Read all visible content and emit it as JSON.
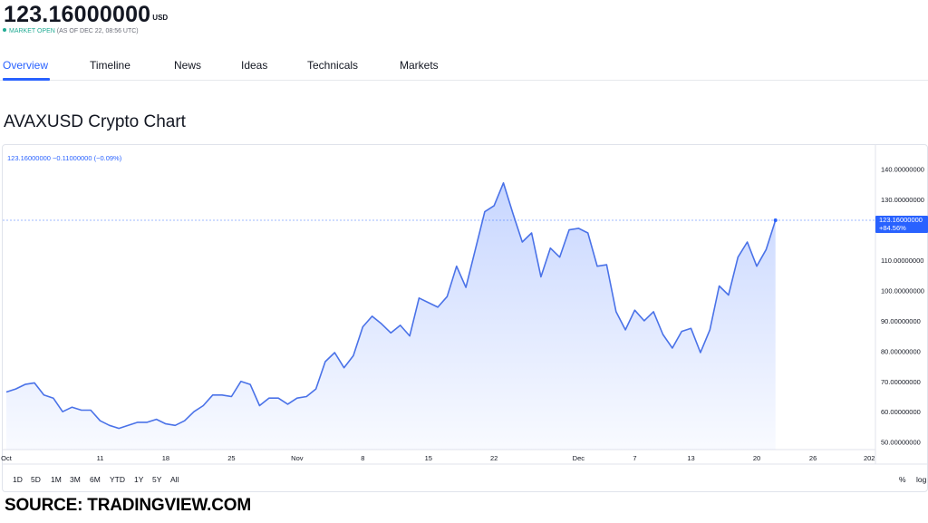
{
  "header": {
    "price": "123.16000000",
    "currency": "USD",
    "market_status": "MARKET OPEN",
    "as_of": "(AS OF DEC 22, 08:56 UTC)"
  },
  "tabs": [
    {
      "label": "Overview",
      "active": true
    },
    {
      "label": "Timeline",
      "active": false
    },
    {
      "label": "News",
      "active": false
    },
    {
      "label": "Ideas",
      "active": false
    },
    {
      "label": "Technicals",
      "active": false
    },
    {
      "label": "Markets",
      "active": false
    }
  ],
  "chart_title": "AVAXUSD Crypto Chart",
  "legend_text": "123.16000000 −0.11000000 (−0.09%)",
  "price_label": {
    "value": "123.16000000",
    "change": "+84.56%"
  },
  "range_buttons": [
    "1D",
    "5D",
    "1M",
    "3M",
    "6M",
    "YTD",
    "1Y",
    "5Y",
    "All"
  ],
  "scale_buttons": [
    "%",
    "log"
  ],
  "source_text": "SOURCE: TRADINGVIEW.COM",
  "colors": {
    "line": "#4a72e8",
    "accent": "#2962ff",
    "status": "#22ab94"
  },
  "chart_data": {
    "type": "area",
    "title": "",
    "xlabel": "",
    "ylabel": "",
    "x_tick_labels": [
      "Oct",
      "11",
      "18",
      "25",
      "Nov",
      "8",
      "15",
      "22",
      "Dec",
      "7",
      "13",
      "20",
      "26",
      "202"
    ],
    "y_tick_labels": [
      "140.00000000",
      "130.00000000",
      "110.00000000",
      "100.00000000",
      "90.00000000",
      "80.00000000",
      "70.00000000",
      "60.00000000",
      "50.00000000"
    ],
    "y_ticks": [
      140,
      130,
      110,
      100,
      90,
      80,
      70,
      60,
      50
    ],
    "ylim": [
      47.5,
      148
    ],
    "grid": false,
    "last_value": 123.16,
    "series": [
      {
        "x": [
          "Oct 1",
          "Oct 2",
          "Oct 3",
          "Oct 4",
          "Oct 5",
          "Oct 6",
          "Oct 7",
          "Oct 8",
          "Oct 9",
          "Oct 10",
          "Oct 11",
          "Oct 12",
          "Oct 13",
          "Oct 14",
          "Oct 15",
          "Oct 16",
          "Oct 17",
          "Oct 18",
          "Oct 19",
          "Oct 20",
          "Oct 21",
          "Oct 22",
          "Oct 23",
          "Oct 24",
          "Oct 25",
          "Oct 26",
          "Oct 27",
          "Oct 28",
          "Oct 29",
          "Oct 30",
          "Oct 31",
          "Nov 1",
          "Nov 2",
          "Nov 3",
          "Nov 4",
          "Nov 5",
          "Nov 6",
          "Nov 7",
          "Nov 8",
          "Nov 9",
          "Nov 10",
          "Nov 11",
          "Nov 12",
          "Nov 13",
          "Nov 14",
          "Nov 15",
          "Nov 16",
          "Nov 17",
          "Nov 18",
          "Nov 19",
          "Nov 20",
          "Nov 21",
          "Nov 22",
          "Nov 23",
          "Nov 24",
          "Nov 25",
          "Nov 26",
          "Nov 27",
          "Nov 28",
          "Nov 29",
          "Nov 30",
          "Dec 1",
          "Dec 2",
          "Dec 3",
          "Dec 4",
          "Dec 5",
          "Dec 6",
          "Dec 7",
          "Dec 8",
          "Dec 9",
          "Dec 10",
          "Dec 11",
          "Dec 12",
          "Dec 13",
          "Dec 14",
          "Dec 15",
          "Dec 16",
          "Dec 17",
          "Dec 18",
          "Dec 19",
          "Dec 20",
          "Dec 21",
          "Dec 22"
        ],
        "values": [
          66.5,
          67.5,
          69,
          69.5,
          65.5,
          64.5,
          60,
          61.5,
          60.5,
          60.5,
          57,
          55.5,
          54.5,
          55.5,
          56.5,
          56.5,
          57.5,
          56,
          55.5,
          57,
          60,
          62,
          65.5,
          65.5,
          65,
          70,
          69,
          62,
          64.5,
          64.5,
          62.5,
          64.5,
          65,
          67.5,
          76.5,
          79.5,
          74.5,
          78.5,
          88,
          91.5,
          89,
          86,
          88.5,
          85,
          97.5,
          96,
          94.5,
          98,
          108,
          101,
          113.5,
          126,
          128,
          135.5,
          125.5,
          116,
          119,
          104.5,
          114,
          111,
          120,
          120.5,
          119,
          108,
          108.5,
          93,
          87,
          93.5,
          90,
          93,
          85.5,
          81,
          86.5,
          87.5,
          79.5,
          87,
          101.5,
          98.5,
          111,
          116,
          108,
          113.5,
          123.16
        ]
      }
    ]
  }
}
